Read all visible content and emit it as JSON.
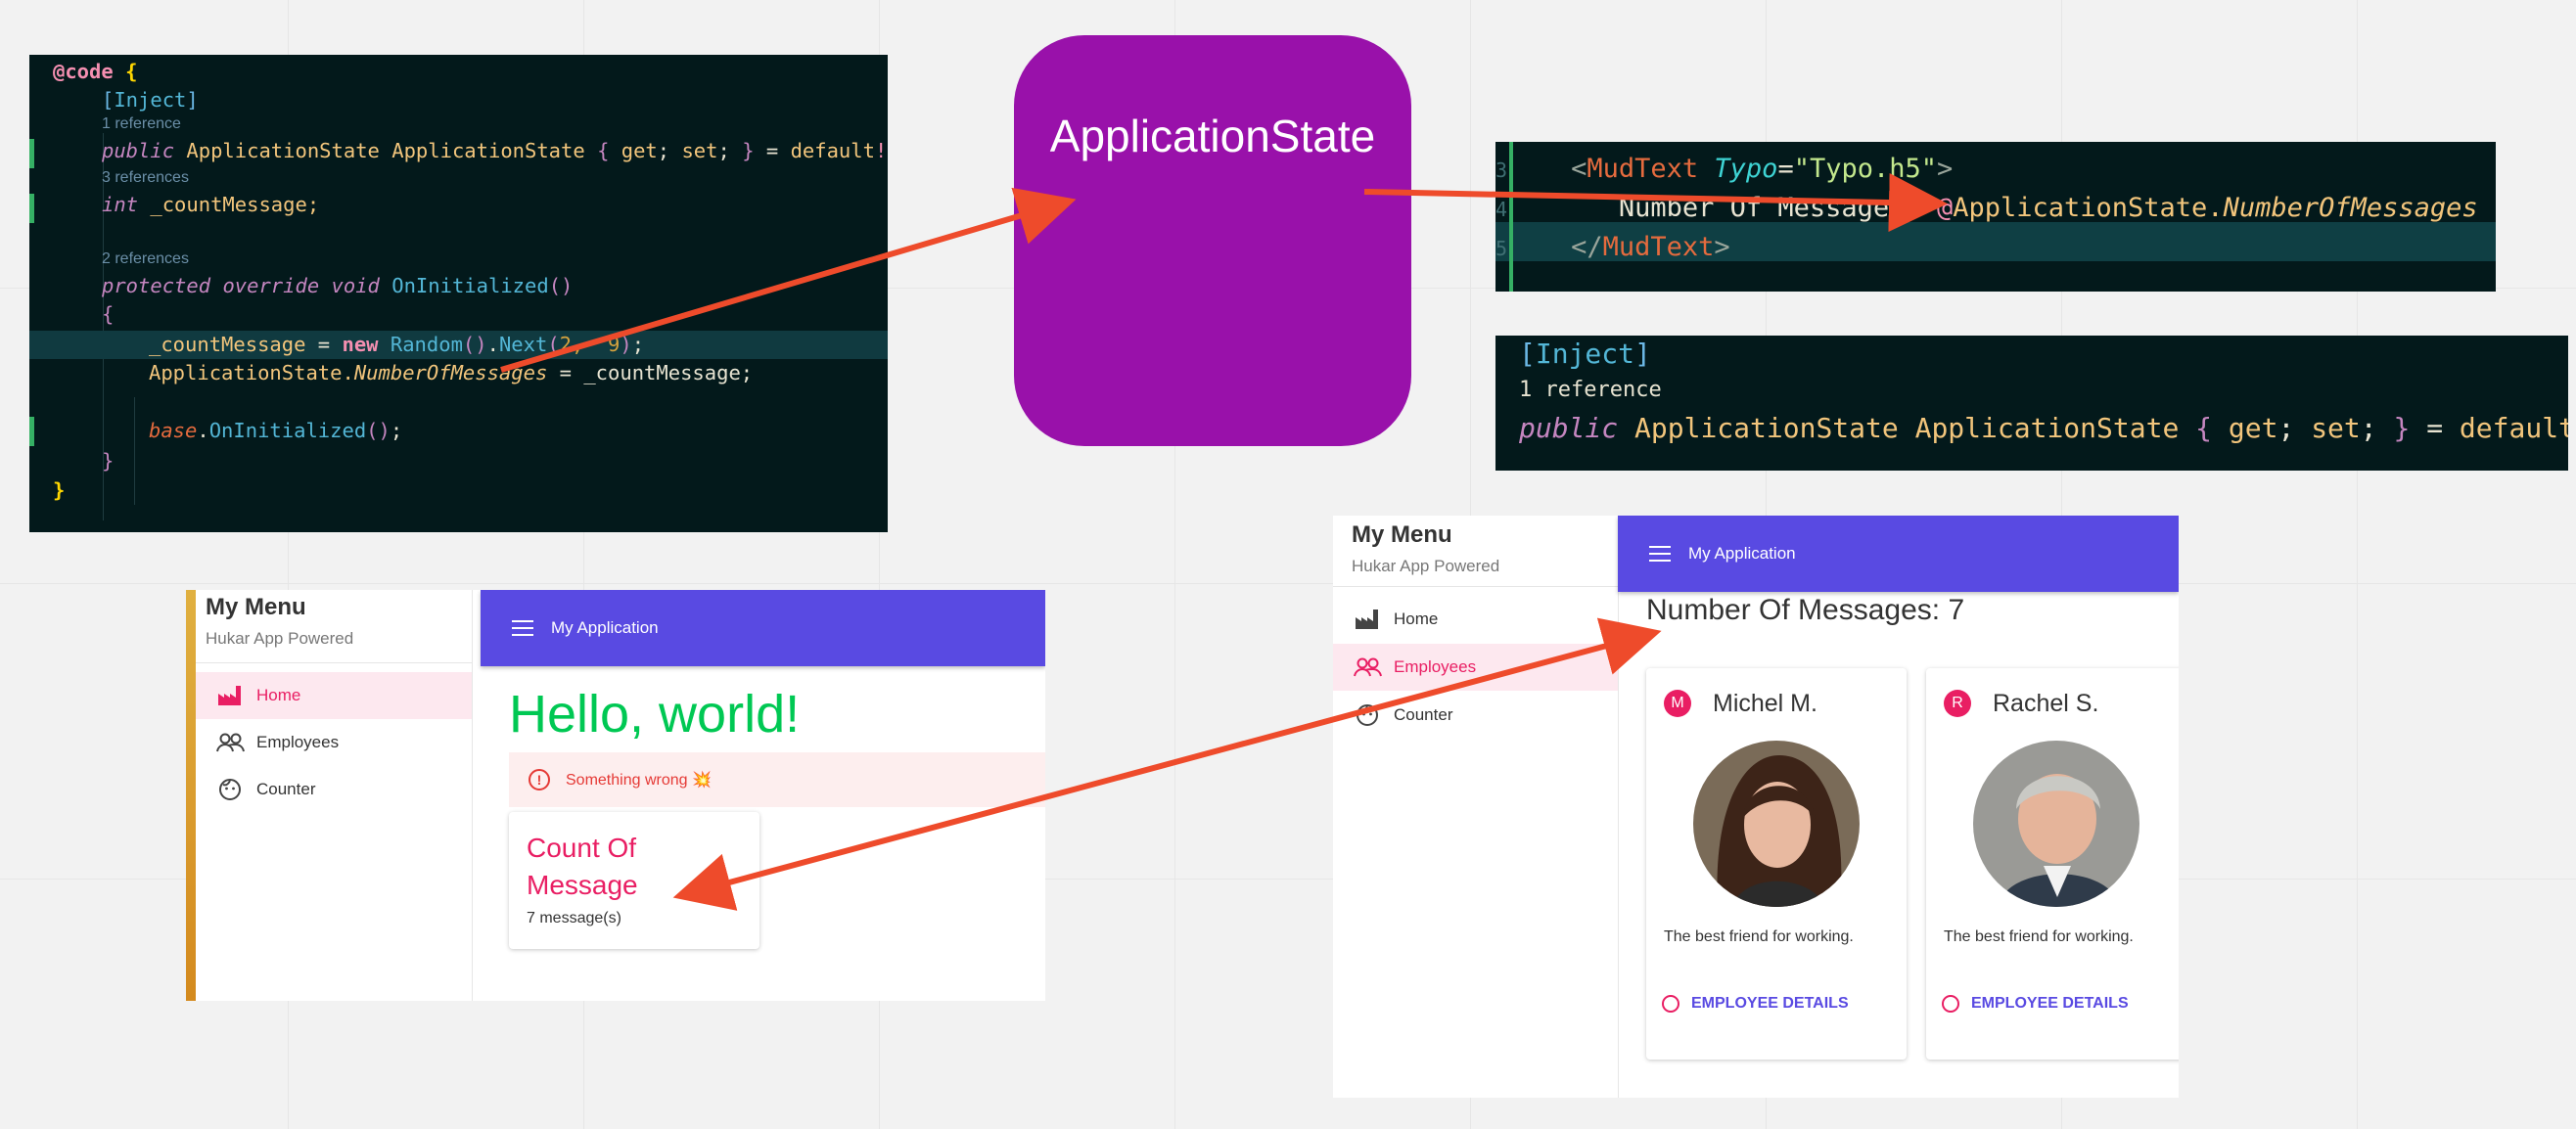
{
  "diagram": {
    "state_label": "ApplicationState"
  },
  "code_page": {
    "l1_kw": "@code",
    "l2": "Inject",
    "ref1": "1 reference",
    "l3_mod": "public",
    "l3_type": "ApplicationState",
    "l3_name": "ApplicationState",
    "l3_get": "get",
    "l3_set": "set",
    "l3_default": "default",
    "ref2": "3 references",
    "l4_type": "int",
    "l4_name": "_countMessage;",
    "ref3": "2 references",
    "l5_mod1": "protected",
    "l5_mod2": "override",
    "l5_void": "void",
    "l5_fn": "OnInitialized",
    "l6_var": "_countMessage",
    "l6_new": "new",
    "l6_cls": "Random",
    "l6_next": "Next",
    "l6_args": "2,  9",
    "l7_obj": "ApplicationState.",
    "l7_prop": "NumberOfMessages",
    "l7_rest": " = _countMessage;",
    "l8_base": "base",
    "l8_fn": "OnInitialized"
  },
  "code_razor": {
    "gutter1": "3",
    "gutter2": "4",
    "gutter3": "5",
    "tag": "MudText",
    "attr": "Typo",
    "value": "\"Typo.h5\"",
    "text": "Number Of Messages: ",
    "at": "@",
    "obj": "ApplicationState.",
    "prop": "NumberOfMessages"
  },
  "code_inject": {
    "attr": "Inject",
    "ref": "1 reference",
    "mod": "public",
    "type": "ApplicationState",
    "name": "ApplicationState",
    "get": "get",
    "set": "set",
    "default": "default"
  },
  "app_left": {
    "menu_title": "My Menu",
    "menu_sub": "Hukar App Powered",
    "nav": [
      "Home",
      "Employees",
      "Counter"
    ],
    "appbar_title": "My Application",
    "heading": "Hello, world!",
    "alert": "Something wrong 💥",
    "card_title": "Count Of Message",
    "card_text": "7 message(s)"
  },
  "app_right": {
    "menu_title": "My Menu",
    "menu_sub": "Hukar App Powered",
    "nav": [
      "Home",
      "Employees",
      "Counter"
    ],
    "appbar_title": "My Application",
    "heading": "Number Of Messages: 7",
    "employees": [
      {
        "initial": "M",
        "name": "Michel M.",
        "text": "The best friend for working.",
        "action": "EMPLOYEE DETAILS"
      },
      {
        "initial": "R",
        "name": "Rachel S.",
        "text": "The best friend for working.",
        "action": "EMPLOYEE DETAILS"
      }
    ]
  },
  "colors": {
    "canvas": "#f2f2f2",
    "code_bg": "#03191b",
    "state_box": "#9911aa",
    "arrow": "#ee4b2b",
    "appbar": "#594ae2",
    "accent_pink": "#e91e63",
    "hello_green": "#00c853",
    "nav_active_bg": "#fde8ef"
  }
}
